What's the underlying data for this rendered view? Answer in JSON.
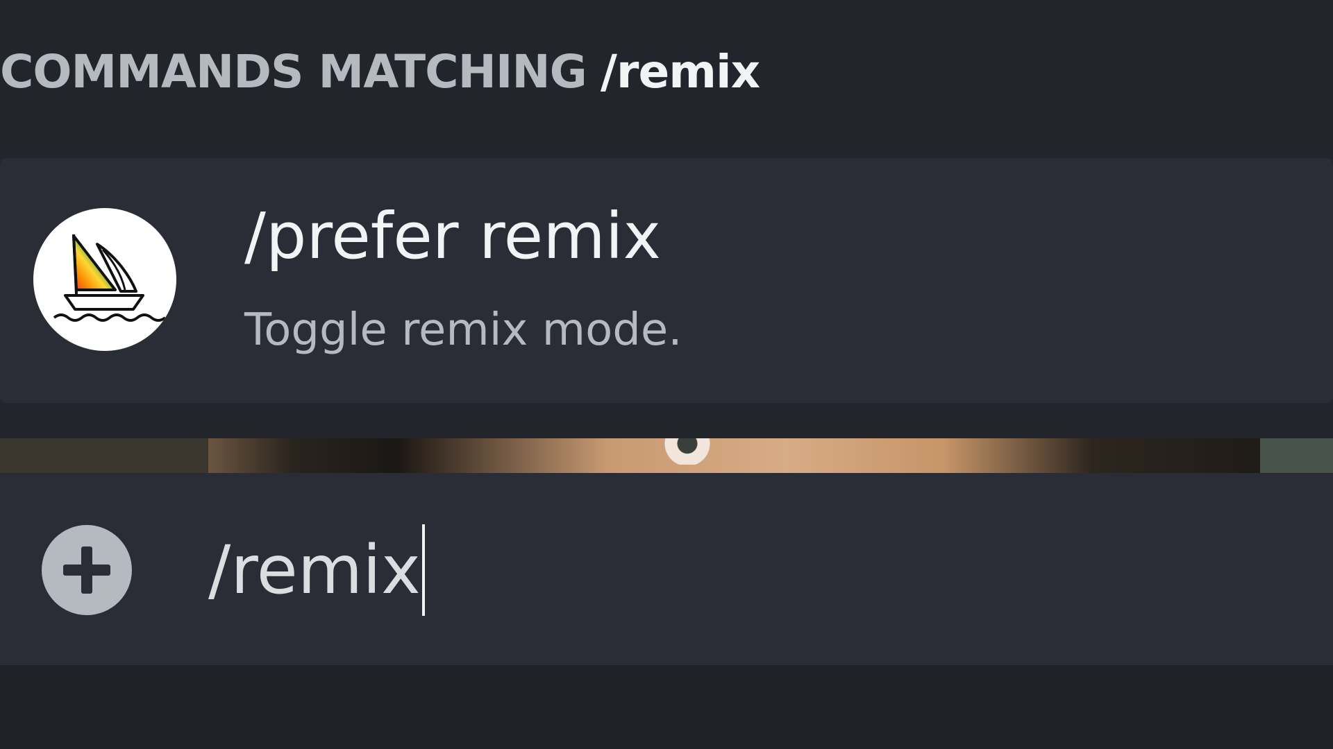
{
  "popup": {
    "header_label": "COMMANDS MATCHING",
    "header_query": "/remix",
    "command": {
      "name": "/prefer remix",
      "description": "Toggle remix mode.",
      "avatar_icon": "sailboat-rainbow-icon"
    }
  },
  "chat_input": {
    "value": "/remix",
    "add_icon": "plus-circle-icon"
  },
  "colors": {
    "background": "#1f2128",
    "panel": "#2b2d36",
    "muted_text": "#b5bac1",
    "bright_text": "#f2f3f5"
  }
}
